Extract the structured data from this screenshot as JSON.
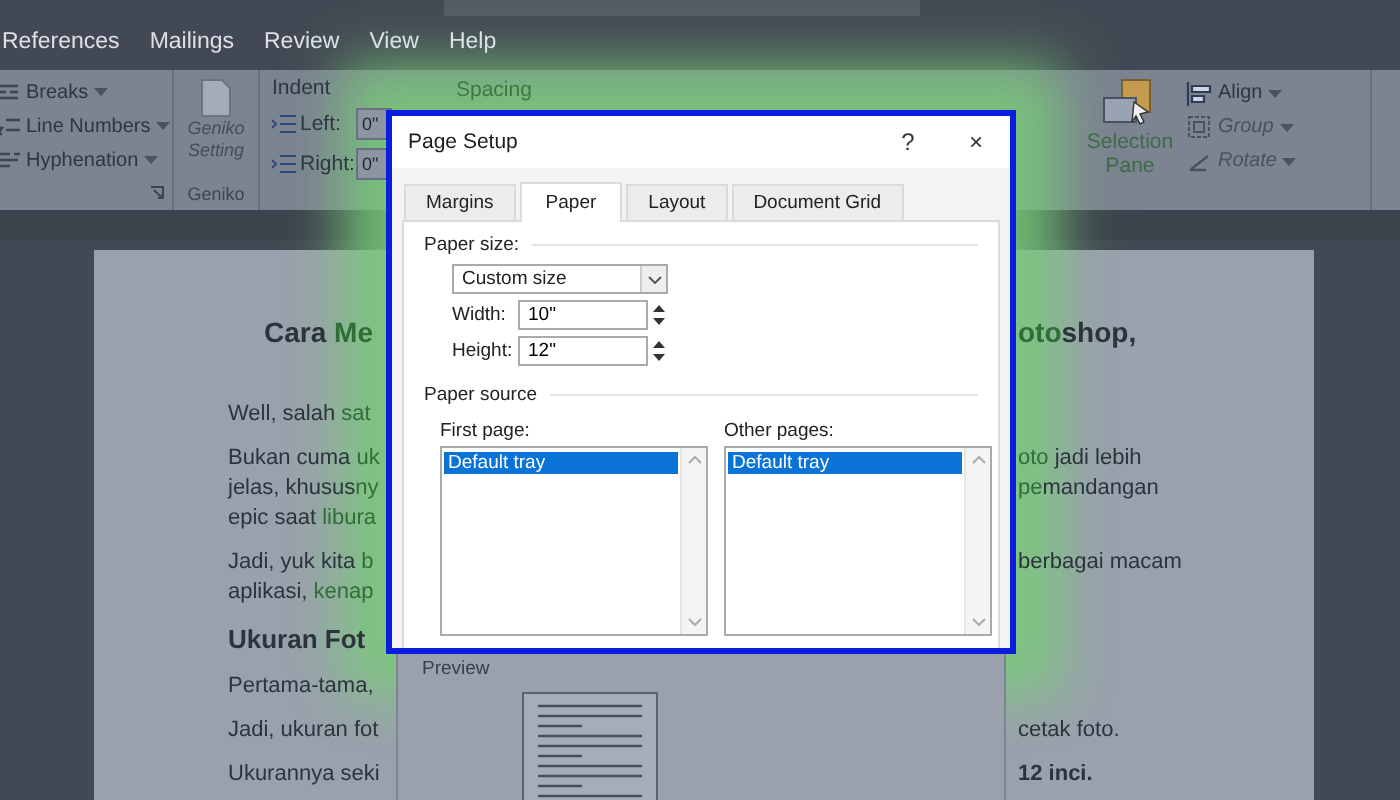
{
  "menu_tabs": [
    {
      "label": "References",
      "selected": false
    },
    {
      "label": "Mailings",
      "selected": false
    },
    {
      "label": "Review",
      "selected": false
    },
    {
      "label": "View",
      "selected": false
    },
    {
      "label": "Help",
      "selected": false
    }
  ],
  "ribbon": {
    "layout_items": [
      {
        "kind": "breaks",
        "label": "Breaks",
        "disabled": false
      },
      {
        "kind": "line-numbers",
        "label": "Line Numbers",
        "disabled": false
      },
      {
        "kind": "hyphenation",
        "label": "Hyphenation",
        "disabled": false
      }
    ],
    "geniko_group": {
      "button": {
        "label": "Geniko Setting",
        "disabled": true
      },
      "label": "Geniko"
    },
    "indent_group": {
      "label": "Indent",
      "fields": [
        {
          "label": "Left:",
          "value": "0\""
        },
        {
          "label": "Right:",
          "value": "0\""
        }
      ]
    },
    "spacing_group": {
      "label": "Spacing"
    },
    "selection_pane": {
      "label": "Selection Pane"
    },
    "arrange_items": [
      {
        "kind": "align",
        "label": "Align",
        "disabled": false
      },
      {
        "kind": "group",
        "label": "Group",
        "disabled": true
      },
      {
        "kind": "rotate",
        "label": "Rotate",
        "disabled": true
      }
    ]
  },
  "document": {
    "paragraphs": [
      {
        "kind": "title",
        "lines": [
          {
            "left": [
              {
                "text": "Cara ",
                "kind": "plain"
              },
              {
                "text": "Me",
                "kind": "link"
              }
            ],
            "right": [
              {
                "text": "oto",
                "kind": "link"
              },
              {
                "text": "shop,",
                "kind": "plain"
              }
            ]
          }
        ]
      },
      {
        "kind": "body",
        "lines": [
          {
            "left": [
              {
                "text": "Well, salah ",
                "kind": "plain"
              },
              {
                "text": "sat",
                "kind": "link"
              }
            ]
          }
        ]
      },
      {
        "kind": "body",
        "lines": [
          {
            "left": [
              {
                "text": "Bukan cuma ",
                "kind": "plain"
              },
              {
                "text": "uk",
                "kind": "link"
              }
            ],
            "right": [
              {
                "text": "oto",
                "kind": "link"
              },
              {
                "text": " jadi lebih",
                "kind": "plain"
              }
            ]
          },
          {
            "left": [
              {
                "text": "jelas, khusus",
                "kind": "plain"
              },
              {
                "text": "ny",
                "kind": "link"
              }
            ],
            "right": [
              {
                "text": "pe",
                "kind": "link"
              },
              {
                "text": "mandangan",
                "kind": "plain"
              }
            ]
          },
          {
            "left": [
              {
                "text": "epic saat ",
                "kind": "plain"
              },
              {
                "text": "libura",
                "kind": "link"
              }
            ]
          }
        ]
      },
      {
        "kind": "body",
        "lines": [
          {
            "left": [
              {
                "text": "Jadi, yuk kita ",
                "kind": "plain"
              },
              {
                "text": "b",
                "kind": "link"
              }
            ],
            "right": [
              {
                "text": "berbagai macam",
                "kind": "plain"
              }
            ]
          },
          {
            "left": [
              {
                "text": "aplikasi, ",
                "kind": "plain"
              },
              {
                "text": "kenap",
                "kind": "link"
              }
            ]
          }
        ]
      },
      {
        "kind": "subtitle",
        "lines": [
          {
            "left": [
              {
                "text": "Ukuran Fot",
                "kind": "plain"
              }
            ]
          }
        ]
      },
      {
        "kind": "body",
        "lines": [
          {
            "left": [
              {
                "text": "Pertama-tama,",
                "kind": "plain"
              }
            ]
          }
        ]
      },
      {
        "kind": "body",
        "lines": [
          {
            "left": [
              {
                "text": "Jadi, ukuran fot",
                "kind": "plain"
              }
            ],
            "right": [
              {
                "text": "cetak foto.",
                "kind": "plain"
              }
            ]
          }
        ]
      },
      {
        "kind": "body",
        "lines": [
          {
            "left": [
              {
                "text": "Ukurannya seki",
                "kind": "plain"
              }
            ],
            "right": [
              {
                "text": "12 inci.",
                "kind": "bold"
              }
            ]
          }
        ]
      }
    ]
  },
  "dialog": {
    "title": "Page Setup",
    "help": "?",
    "close": "×",
    "tabs": [
      {
        "label": "Margins",
        "selected": false
      },
      {
        "label": "Paper",
        "selected": true
      },
      {
        "label": "Layout",
        "selected": false
      },
      {
        "label": "Document Grid",
        "selected": false
      }
    ],
    "paper_size": {
      "label": "Paper size:",
      "select": "Custom size",
      "fields": [
        {
          "label": "Width:",
          "value": "10\""
        },
        {
          "label": "Height:",
          "value": "12\""
        }
      ]
    },
    "paper_source": {
      "label": "Paper source",
      "lists": [
        {
          "label": "First page:",
          "items": [
            {
              "label": "Default tray",
              "selected": true
            }
          ]
        },
        {
          "label": "Other pages:",
          "items": [
            {
              "label": "Default tray",
              "selected": true
            }
          ]
        }
      ]
    },
    "preview": {
      "label": "Preview"
    }
  }
}
